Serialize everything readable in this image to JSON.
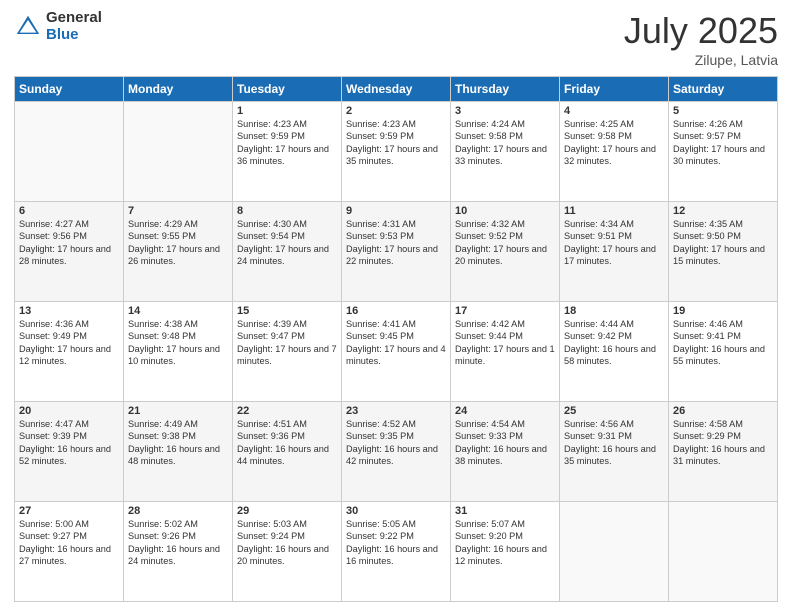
{
  "logo": {
    "general": "General",
    "blue": "Blue"
  },
  "header": {
    "month": "July 2025",
    "location": "Zilupe, Latvia"
  },
  "weekdays": [
    "Sunday",
    "Monday",
    "Tuesday",
    "Wednesday",
    "Thursday",
    "Friday",
    "Saturday"
  ],
  "weeks": [
    [
      {
        "day": "",
        "info": ""
      },
      {
        "day": "",
        "info": ""
      },
      {
        "day": "1",
        "info": "Sunrise: 4:23 AM\nSunset: 9:59 PM\nDaylight: 17 hours and 36 minutes."
      },
      {
        "day": "2",
        "info": "Sunrise: 4:23 AM\nSunset: 9:59 PM\nDaylight: 17 hours and 35 minutes."
      },
      {
        "day": "3",
        "info": "Sunrise: 4:24 AM\nSunset: 9:58 PM\nDaylight: 17 hours and 33 minutes."
      },
      {
        "day": "4",
        "info": "Sunrise: 4:25 AM\nSunset: 9:58 PM\nDaylight: 17 hours and 32 minutes."
      },
      {
        "day": "5",
        "info": "Sunrise: 4:26 AM\nSunset: 9:57 PM\nDaylight: 17 hours and 30 minutes."
      }
    ],
    [
      {
        "day": "6",
        "info": "Sunrise: 4:27 AM\nSunset: 9:56 PM\nDaylight: 17 hours and 28 minutes."
      },
      {
        "day": "7",
        "info": "Sunrise: 4:29 AM\nSunset: 9:55 PM\nDaylight: 17 hours and 26 minutes."
      },
      {
        "day": "8",
        "info": "Sunrise: 4:30 AM\nSunset: 9:54 PM\nDaylight: 17 hours and 24 minutes."
      },
      {
        "day": "9",
        "info": "Sunrise: 4:31 AM\nSunset: 9:53 PM\nDaylight: 17 hours and 22 minutes."
      },
      {
        "day": "10",
        "info": "Sunrise: 4:32 AM\nSunset: 9:52 PM\nDaylight: 17 hours and 20 minutes."
      },
      {
        "day": "11",
        "info": "Sunrise: 4:34 AM\nSunset: 9:51 PM\nDaylight: 17 hours and 17 minutes."
      },
      {
        "day": "12",
        "info": "Sunrise: 4:35 AM\nSunset: 9:50 PM\nDaylight: 17 hours and 15 minutes."
      }
    ],
    [
      {
        "day": "13",
        "info": "Sunrise: 4:36 AM\nSunset: 9:49 PM\nDaylight: 17 hours and 12 minutes."
      },
      {
        "day": "14",
        "info": "Sunrise: 4:38 AM\nSunset: 9:48 PM\nDaylight: 17 hours and 10 minutes."
      },
      {
        "day": "15",
        "info": "Sunrise: 4:39 AM\nSunset: 9:47 PM\nDaylight: 17 hours and 7 minutes."
      },
      {
        "day": "16",
        "info": "Sunrise: 4:41 AM\nSunset: 9:45 PM\nDaylight: 17 hours and 4 minutes."
      },
      {
        "day": "17",
        "info": "Sunrise: 4:42 AM\nSunset: 9:44 PM\nDaylight: 17 hours and 1 minute."
      },
      {
        "day": "18",
        "info": "Sunrise: 4:44 AM\nSunset: 9:42 PM\nDaylight: 16 hours and 58 minutes."
      },
      {
        "day": "19",
        "info": "Sunrise: 4:46 AM\nSunset: 9:41 PM\nDaylight: 16 hours and 55 minutes."
      }
    ],
    [
      {
        "day": "20",
        "info": "Sunrise: 4:47 AM\nSunset: 9:39 PM\nDaylight: 16 hours and 52 minutes."
      },
      {
        "day": "21",
        "info": "Sunrise: 4:49 AM\nSunset: 9:38 PM\nDaylight: 16 hours and 48 minutes."
      },
      {
        "day": "22",
        "info": "Sunrise: 4:51 AM\nSunset: 9:36 PM\nDaylight: 16 hours and 44 minutes."
      },
      {
        "day": "23",
        "info": "Sunrise: 4:52 AM\nSunset: 9:35 PM\nDaylight: 16 hours and 42 minutes."
      },
      {
        "day": "24",
        "info": "Sunrise: 4:54 AM\nSunset: 9:33 PM\nDaylight: 16 hours and 38 minutes."
      },
      {
        "day": "25",
        "info": "Sunrise: 4:56 AM\nSunset: 9:31 PM\nDaylight: 16 hours and 35 minutes."
      },
      {
        "day": "26",
        "info": "Sunrise: 4:58 AM\nSunset: 9:29 PM\nDaylight: 16 hours and 31 minutes."
      }
    ],
    [
      {
        "day": "27",
        "info": "Sunrise: 5:00 AM\nSunset: 9:27 PM\nDaylight: 16 hours and 27 minutes."
      },
      {
        "day": "28",
        "info": "Sunrise: 5:02 AM\nSunset: 9:26 PM\nDaylight: 16 hours and 24 minutes."
      },
      {
        "day": "29",
        "info": "Sunrise: 5:03 AM\nSunset: 9:24 PM\nDaylight: 16 hours and 20 minutes."
      },
      {
        "day": "30",
        "info": "Sunrise: 5:05 AM\nSunset: 9:22 PM\nDaylight: 16 hours and 16 minutes."
      },
      {
        "day": "31",
        "info": "Sunrise: 5:07 AM\nSunset: 9:20 PM\nDaylight: 16 hours and 12 minutes."
      },
      {
        "day": "",
        "info": ""
      },
      {
        "day": "",
        "info": ""
      }
    ]
  ]
}
